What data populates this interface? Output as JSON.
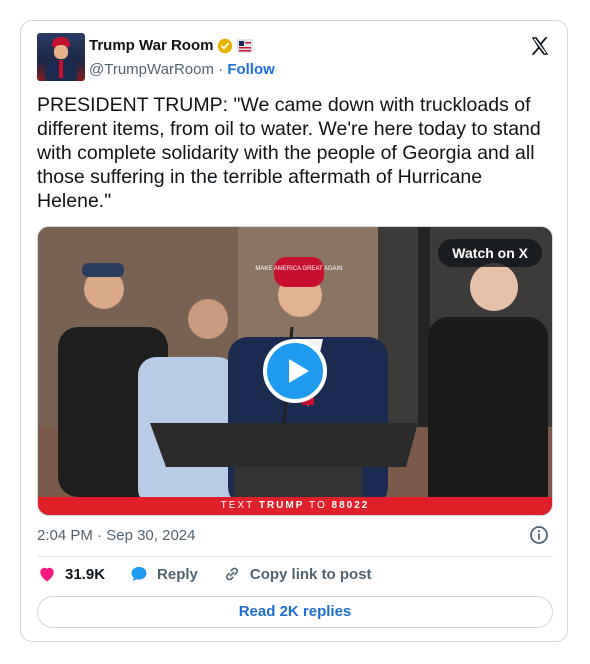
{
  "author": {
    "name": "Trump War Room",
    "handle": "@TrumpWarRoom",
    "follow_label": "Follow"
  },
  "tweet": {
    "text": "PRESIDENT TRUMP: \"We came down with truckloads of different items, from oil to water. We're here today to stand with complete solidarity with the people of Georgia and all those suffering in the terrible aftermath of Hurricane Helene.\""
  },
  "media": {
    "watch_label": "Watch on X",
    "banner_prefix": "TEXT",
    "banner_word": "TRUMP",
    "banner_to": "TO",
    "banner_number": "88022",
    "hat_text": "MAKE AMERICA GREAT AGAIN"
  },
  "meta": {
    "time": "2:04 PM",
    "date": "Sep 30, 2024",
    "separator": "·"
  },
  "actions": {
    "likes": "31.9K",
    "reply_label": "Reply",
    "copy_label": "Copy link to post",
    "read_replies": "Read 2K replies"
  },
  "colors": {
    "accent": "#1d9bf0",
    "link": "#1d6fd6",
    "like": "#f91880",
    "banner": "#e02028"
  },
  "icons": [
    "verified-badge-icon",
    "flag-icon",
    "x-logo-icon",
    "play-icon",
    "info-icon",
    "heart-icon",
    "reply-bubble-icon",
    "link-icon"
  ]
}
